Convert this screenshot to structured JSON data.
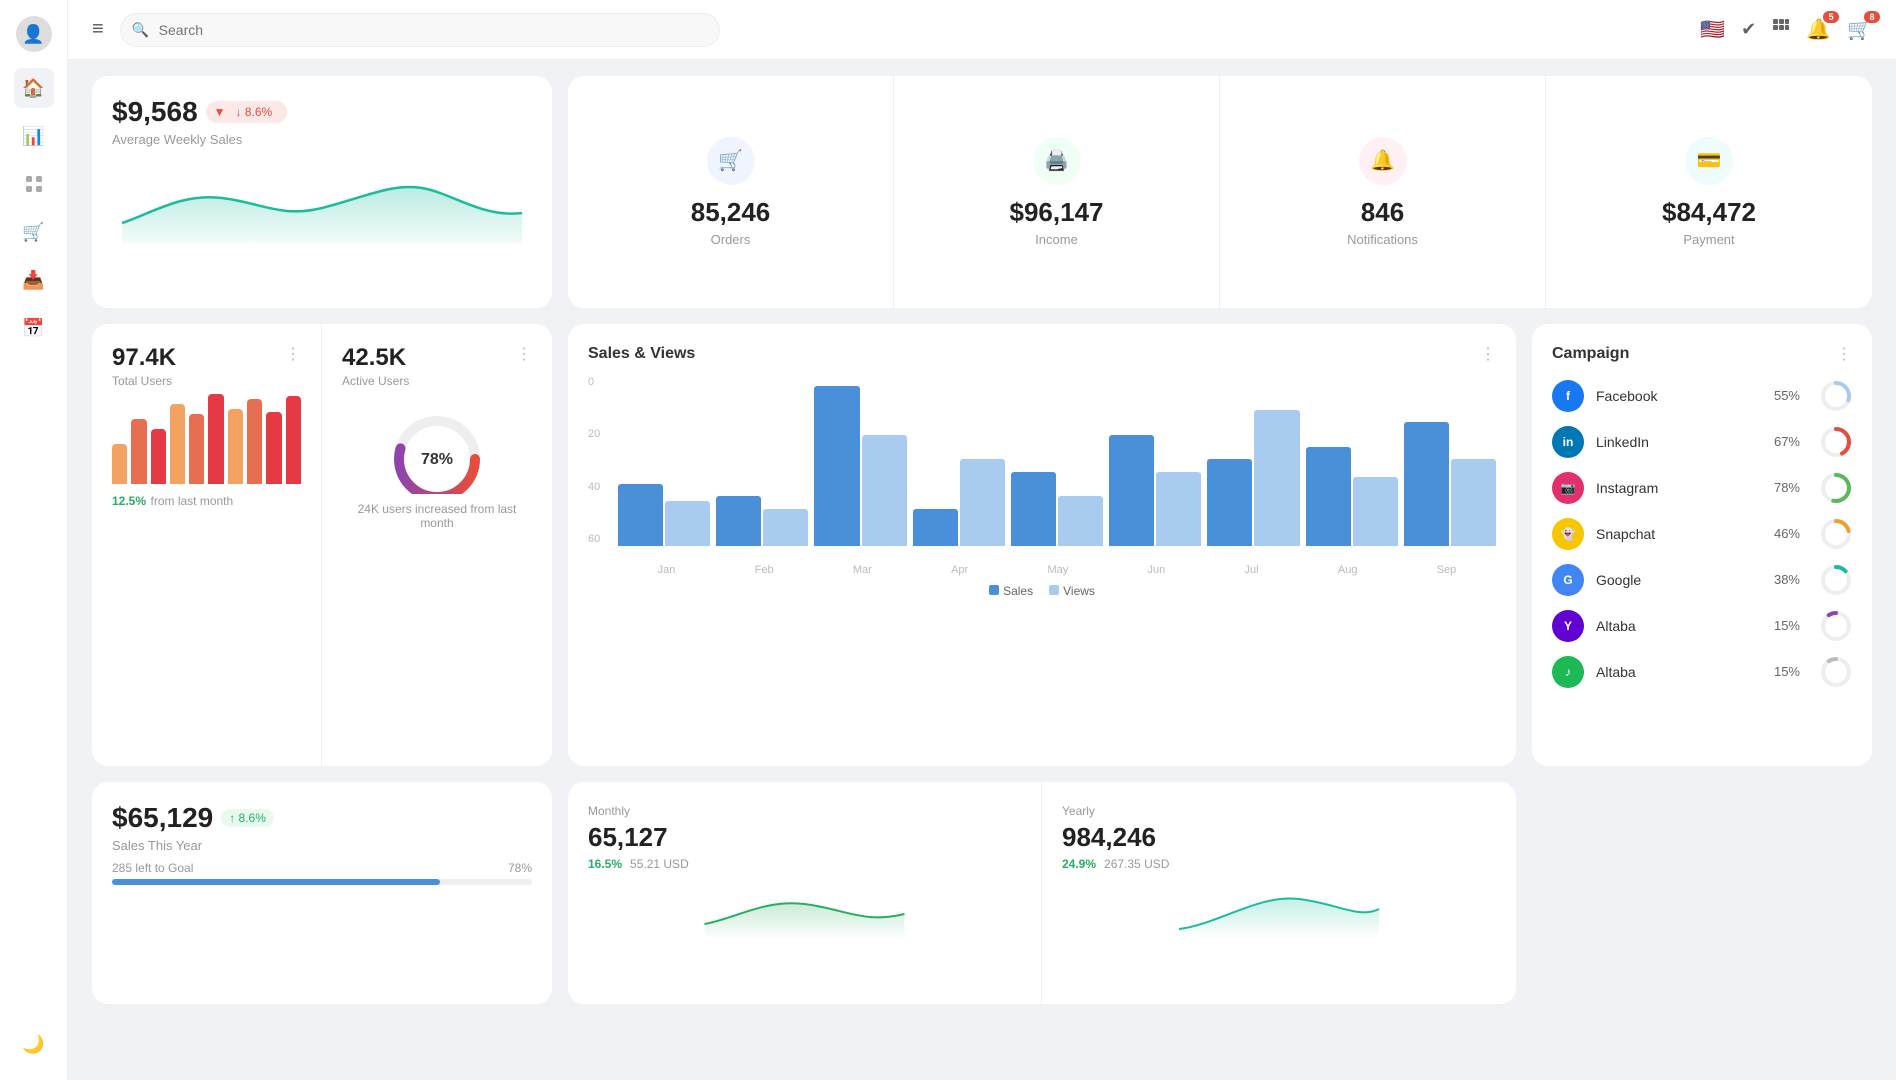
{
  "sidebar": {
    "avatar_icon": "👤",
    "items": [
      {
        "id": "home",
        "icon": "🏠",
        "active": true
      },
      {
        "id": "chart",
        "icon": "📊"
      },
      {
        "id": "grid",
        "icon": "⊞"
      },
      {
        "id": "cart",
        "icon": "🛒"
      },
      {
        "id": "inbox",
        "icon": "📥"
      },
      {
        "id": "calendar",
        "icon": "📅"
      }
    ],
    "bottom_icon": "🌙"
  },
  "topbar": {
    "menu_label": "≡",
    "search_placeholder": "Search",
    "flag": "🇺🇸",
    "notification_badge": "5",
    "cart_badge": "8"
  },
  "weekly_sales": {
    "amount": "$9,568",
    "change": "↓ 8.6%",
    "label": "Average Weekly Sales"
  },
  "stats": [
    {
      "icon": "🛒",
      "icon_class": "blue",
      "value": "85,246",
      "label": "Orders"
    },
    {
      "icon": "🖨️",
      "icon_class": "green",
      "value": "$96,147",
      "label": "Income"
    },
    {
      "icon": "🔔",
      "icon_class": "pink",
      "value": "846",
      "label": "Notifications"
    },
    {
      "icon": "💳",
      "icon_class": "teal",
      "value": "$84,472",
      "label": "Payment"
    }
  ],
  "total_users": {
    "value": "97.4K",
    "label": "Total Users",
    "change": "12.5%",
    "change_label": " from last month",
    "bars": [
      40,
      65,
      55,
      80,
      70,
      90,
      75,
      85,
      72,
      88
    ]
  },
  "active_users": {
    "value": "42.5K",
    "label": "Active Users",
    "donut_pct": "78%",
    "description": "24K users increased from last month"
  },
  "sales_views": {
    "title": "Sales & Views",
    "y_labels": [
      "0",
      "20",
      "40",
      "60"
    ],
    "x_labels": [
      "Jan",
      "Feb",
      "Mar",
      "Apr",
      "May",
      "Jun",
      "Jul",
      "Aug",
      "Sep"
    ],
    "data": [
      {
        "sales": 25,
        "views": 18
      },
      {
        "sales": 20,
        "views": 15
      },
      {
        "sales": 65,
        "views": 45
      },
      {
        "sales": 15,
        "views": 35
      },
      {
        "sales": 30,
        "views": 20
      },
      {
        "sales": 45,
        "views": 30
      },
      {
        "sales": 35,
        "views": 55
      },
      {
        "sales": 40,
        "views": 28
      },
      {
        "sales": 50,
        "views": 35
      }
    ],
    "legend_sales": "Sales",
    "legend_views": "Views"
  },
  "campaign": {
    "title": "Campaign",
    "items": [
      {
        "name": "Facebook",
        "pct": "55%",
        "color": "#1877f2",
        "stroke": "#aacbf0",
        "label": "F"
      },
      {
        "name": "LinkedIn",
        "pct": "67%",
        "color": "#0077b5",
        "stroke": "#e06b6b",
        "label": "in"
      },
      {
        "name": "Instagram",
        "pct": "78%",
        "color": "#e1306c",
        "stroke": "#5cb85c",
        "label": "📸"
      },
      {
        "name": "Snapchat",
        "pct": "46%",
        "color": "#fffc00",
        "stroke": "#f0a030",
        "label": "👻"
      },
      {
        "name": "Google",
        "pct": "38%",
        "color": "#4285f4",
        "stroke": "#4ac8c8",
        "label": "G"
      },
      {
        "name": "Altaba",
        "pct": "15%",
        "color": "#410093",
        "stroke": "#8844aa",
        "label": "Y"
      },
      {
        "name": "Altaba",
        "pct": "15%",
        "color": "#1db954",
        "stroke": "#cccccc",
        "label": "♪"
      }
    ]
  },
  "sales_year": {
    "amount": "$65,129",
    "change": "↑ 8.6%",
    "label": "Sales This Year",
    "goal_left": "285 left to Goal",
    "pct": "78%",
    "pct_num": 78
  },
  "monthly": {
    "label": "Monthly",
    "value": "65,127",
    "change_pct": "16.5%",
    "change_usd": "55.21 USD"
  },
  "yearly": {
    "label": "Yearly",
    "value": "984,246",
    "change_pct": "24.9%",
    "change_usd": "267.35 USD"
  }
}
